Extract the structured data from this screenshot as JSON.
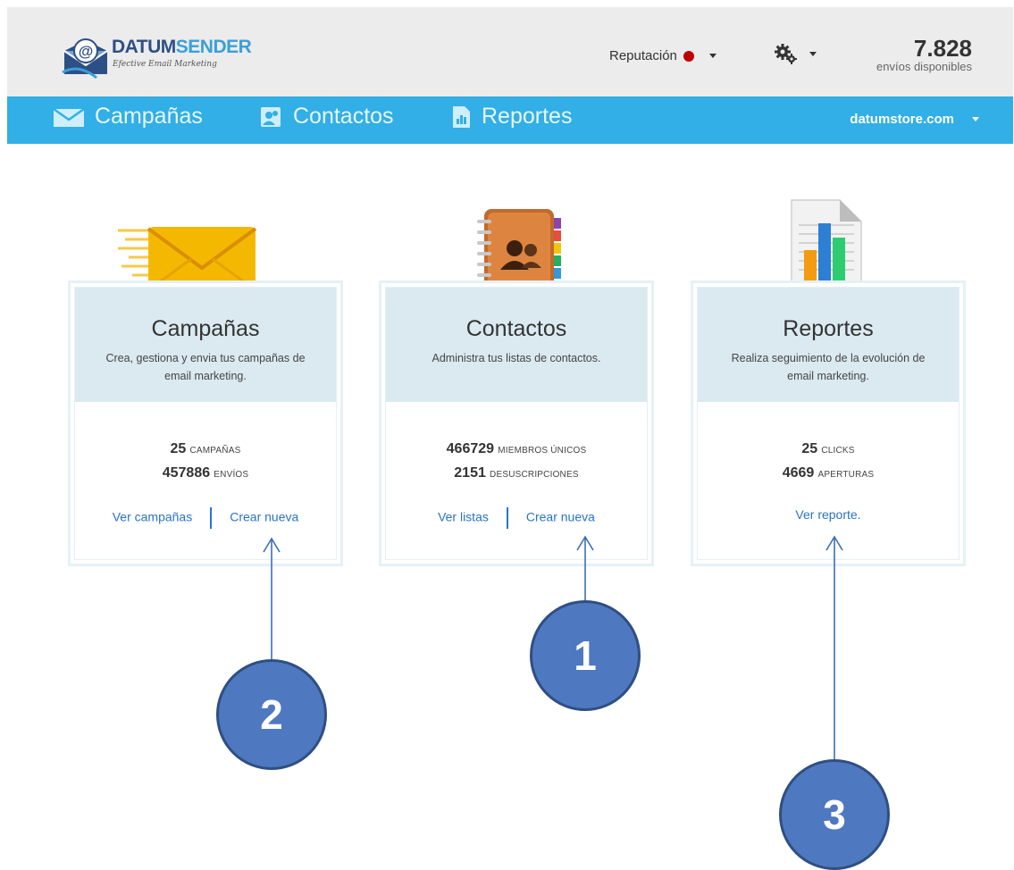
{
  "header": {
    "logo_name_part1": "DATUM",
    "logo_name_part2": "SENDER",
    "logo_tagline": "Efective Email Marketing",
    "reputation_label": "Reputación",
    "reputation_status_color": "#c00000",
    "credits_value": "7.828",
    "credits_label": "envíos disponibles"
  },
  "nav": {
    "items": [
      {
        "label": "Campañas",
        "icon": "envelope-icon"
      },
      {
        "label": "Contactos",
        "icon": "contacts-icon"
      },
      {
        "label": "Reportes",
        "icon": "report-icon"
      }
    ],
    "account": "datumstore.com",
    "bar_color": "#31afe6"
  },
  "cards": [
    {
      "title": "Campañas",
      "description": "Crea, gestiona y envia tus campañas de email marketing.",
      "stats": [
        {
          "value": "25",
          "label": "CAMPAÑAS"
        },
        {
          "value": "457886",
          "label": "ENVÍOS"
        }
      ],
      "links": [
        "Ver campañas",
        "Crear nueva"
      ]
    },
    {
      "title": "Contactos",
      "description": "Administra tus listas de contactos.",
      "stats": [
        {
          "value": "466729",
          "label": "MIEMBROS ÚNICOS"
        },
        {
          "value": "2151",
          "label": "DESUSCRIPCIONES"
        }
      ],
      "links": [
        "Ver listas",
        "Crear nueva"
      ]
    },
    {
      "title": "Reportes",
      "description": "Realiza seguimiento de la evolución de email marketing.",
      "stats": [
        {
          "value": "25",
          "label": "CLICKS"
        },
        {
          "value": "4669",
          "label": "APERTURAS"
        }
      ],
      "links": [
        "Ver reporte."
      ]
    }
  ],
  "callouts": [
    "1",
    "2",
    "3"
  ]
}
